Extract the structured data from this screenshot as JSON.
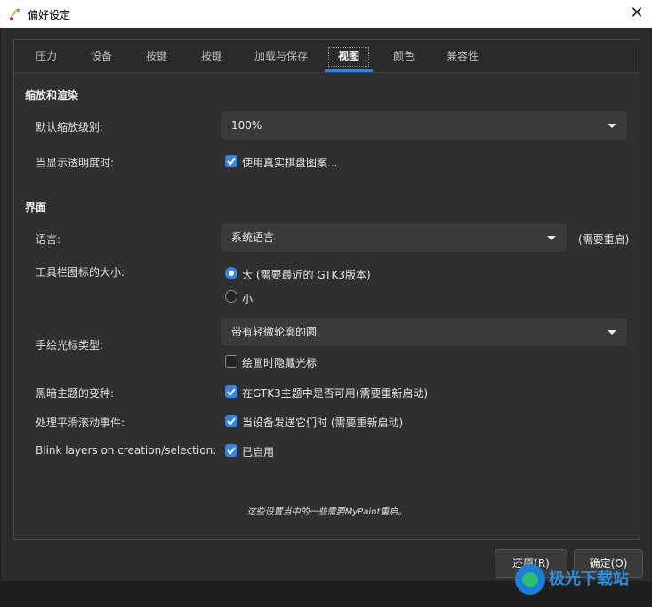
{
  "window": {
    "title": "偏好设定",
    "close_glyph": "✕"
  },
  "tabs": [
    {
      "label": "压力"
    },
    {
      "label": "设备"
    },
    {
      "label": "按键"
    },
    {
      "label": "按键"
    },
    {
      "label": "加载与保存"
    },
    {
      "label": "视图",
      "active": true
    },
    {
      "label": "颜色"
    },
    {
      "label": "兼容性"
    }
  ],
  "zoom_section": {
    "heading": "缩放和渲染",
    "default_zoom_label": "默认缩放级别:",
    "default_zoom_value": "100%",
    "transparency_label": "当显示透明度时:",
    "checkerboard_label": "使用真实棋盘图案...",
    "checkerboard_checked": true
  },
  "interface_section": {
    "heading": "界面",
    "language_label": "语言:",
    "language_value": "系统语言",
    "restart_note": "(需要重启)",
    "toolbar_icon_label": "工具栏图标的大小:",
    "icon_large_label": "大 (需要最近的 GTK3版本)",
    "icon_small_label": "小",
    "icon_size_selected": "large",
    "cursor_label": "手绘光标类型:",
    "cursor_value": "带有轻微轮廓的圆",
    "hide_cursor_label": "绘画时隐藏光标",
    "hide_cursor_checked": false,
    "dark_variant_label": "黑暗主题的变种:",
    "dark_variant_check": "在GTK3主题中是否可用(需要重新启动)",
    "dark_variant_checked": true,
    "smooth_scroll_label": "处理平滑滚动事件:",
    "smooth_scroll_check": "当设备发送它们时 (需要重新启动)",
    "smooth_scroll_checked": true,
    "blink_label": "Blink layers on creation/selection:",
    "blink_check": "已启用",
    "blink_checked": true
  },
  "footnote": "这些设置当中的一些需要MyPaint重启。",
  "buttons": {
    "revert": "还原(R)",
    "ok": "确定(O)"
  },
  "watermark": {
    "text": "极光下载站"
  },
  "colors": {
    "accent": "#3584e4",
    "background": "#2b2b2b"
  }
}
